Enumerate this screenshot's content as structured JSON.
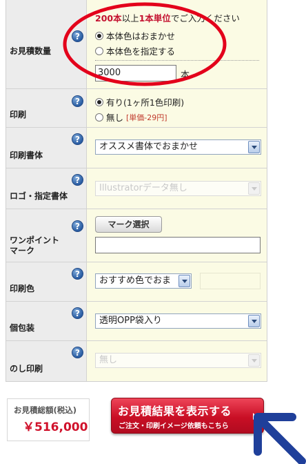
{
  "quantity": {
    "label": "お見積数量",
    "notice_red1": "200本",
    "notice_mid": "以上",
    "notice_red2": "1本単位",
    "notice_tail": "でご入力ください",
    "radio_options": [
      "本体色はおまかせ",
      "本体色を指定する"
    ],
    "selected": "本体色はおまかせ",
    "value": "3000",
    "unit": "本"
  },
  "printing": {
    "label": "印刷",
    "options": [
      {
        "label": "有り(1ヶ所1色印刷)",
        "note": ""
      },
      {
        "label": "無し",
        "note": "[単価-29円]"
      }
    ],
    "selected": "有り(1ヶ所1色印刷)"
  },
  "font": {
    "label": "印刷書体",
    "selected": "オススメ書体でおまかせ"
  },
  "logo": {
    "label": "ロゴ・指定書体",
    "selected": "Illustratorデータ無し"
  },
  "onepoint": {
    "label_line1": "ワンポイント",
    "label_line2": "マーク",
    "button": "マーク選択",
    "value": ""
  },
  "print_color": {
    "label": "印刷色",
    "selected": "おすすめ色でおま"
  },
  "packaging": {
    "label": "個包装",
    "selected": "透明OPP袋入り"
  },
  "noshi": {
    "label": "のし印刷",
    "selected": "無し"
  },
  "help_glyph": "?",
  "total": {
    "label": "お見積総額(税込)",
    "value": "￥516,000"
  },
  "cta": {
    "main": "お見積結果を表示する",
    "sub": "ご注文・印刷イメージ依頼もこちら"
  },
  "colors": {
    "accent_red": "#c90f25",
    "annotation_red": "#e3001b",
    "arrow_blue": "#1f3f9a",
    "value_bg": "#fbfbe4"
  }
}
